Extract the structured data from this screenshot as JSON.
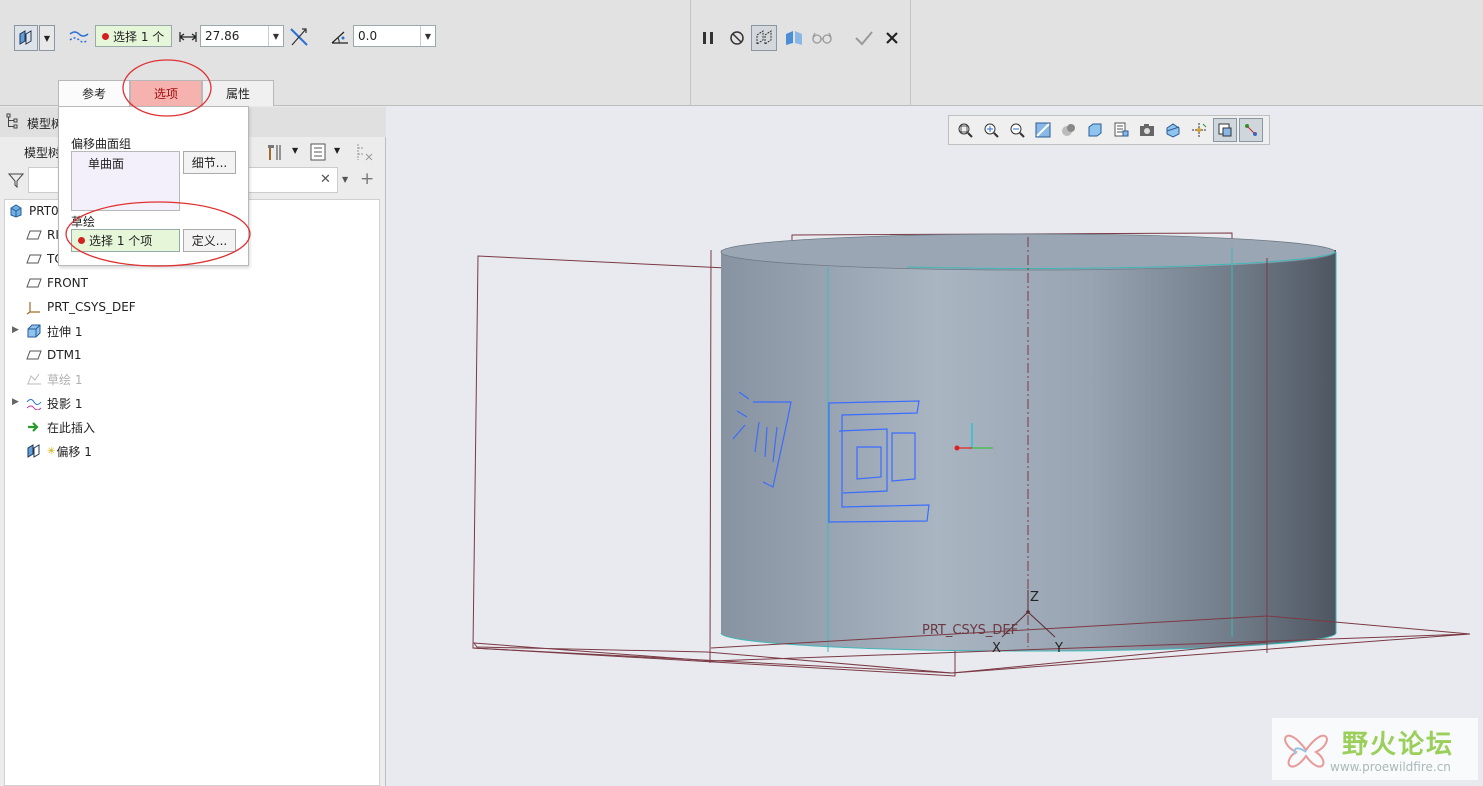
{
  "dashboard": {
    "collector_surface": "选择 1 个",
    "thickness_value": "27.86",
    "angle_value": "0.0"
  },
  "tabs": [
    {
      "label": "参考"
    },
    {
      "label": "选项"
    },
    {
      "label": "属性"
    }
  ],
  "options_panel": {
    "group_label": "偏移曲面组",
    "list_item": "单曲面",
    "details_button": "细节...",
    "sketch_label": "草绘",
    "sketch_collector": "选择 1 个项",
    "define_button": "定义..."
  },
  "model_tree": {
    "header_title": "模型树",
    "toolbar_title": "模型树",
    "items": [
      {
        "label": "PRT0",
        "icon": "part-icon"
      },
      {
        "label": "RI",
        "icon": "datum-plane-icon"
      },
      {
        "label": "TO",
        "icon": "datum-plane-icon"
      },
      {
        "label": "FRONT",
        "icon": "datum-plane-icon"
      },
      {
        "label": "PRT_CSYS_DEF",
        "icon": "csys-icon"
      },
      {
        "label": "拉伸 1",
        "icon": "extrude-icon"
      },
      {
        "label": "DTM1",
        "icon": "datum-plane-icon"
      },
      {
        "label": "草绘 1",
        "icon": "sketch-icon"
      },
      {
        "label": "投影 1",
        "icon": "project-icon"
      },
      {
        "label": "在此插入",
        "icon": "insert-here-icon"
      },
      {
        "label": "偏移 1",
        "icon": "offset-icon"
      }
    ]
  },
  "graphics": {
    "csys_label": "PRT_CSYS_DEF",
    "axis_z": "Z",
    "axis_x": "X",
    "axis_y": "Y",
    "projected_text": "汤臣"
  },
  "watermark": {
    "title": "野火论坛",
    "url": "www.proewildfire.cn"
  },
  "colors": {
    "active_tab": "#f6b2ae",
    "collector_bg": "#e6f7d9",
    "annotation_red": "#e03030",
    "sketch_blue": "#3a6cff",
    "cylinder_body": "#9aa6b3"
  }
}
